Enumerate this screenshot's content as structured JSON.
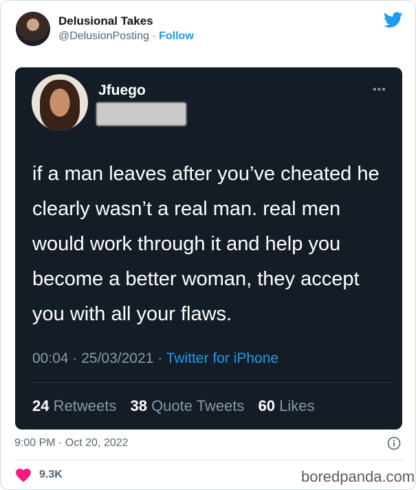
{
  "author": {
    "name": "Delusional Takes",
    "handle": "@DelusionPosting",
    "separator": "·",
    "follow_label": "Follow"
  },
  "embedded_tweet": {
    "author_name": "Jfuego",
    "text": "if a man leaves after you’ve cheated he clearly wasn’t a real man. real men would work through it and help you become a better woman, they accept you with all your flaws.",
    "time": "00:04",
    "date": "25/03/2021",
    "source": "Twitter for iPhone",
    "retweets_count": "24",
    "retweets_label": "Retweets",
    "quotes_count": "38",
    "quotes_label": "Quote Tweets",
    "likes_count": "60",
    "likes_label": "Likes"
  },
  "footer": {
    "timestamp": "9:00 PM · Oct 20, 2022",
    "like_count": "9.3K",
    "watermark": "boredpanda.com"
  },
  "colors": {
    "accent": "#1d9bf0",
    "embed_bg": "#141d26",
    "heart": "#f91880"
  },
  "icons": [
    "twitter-bird-icon",
    "more-options-icon",
    "info-icon",
    "heart-icon"
  ]
}
